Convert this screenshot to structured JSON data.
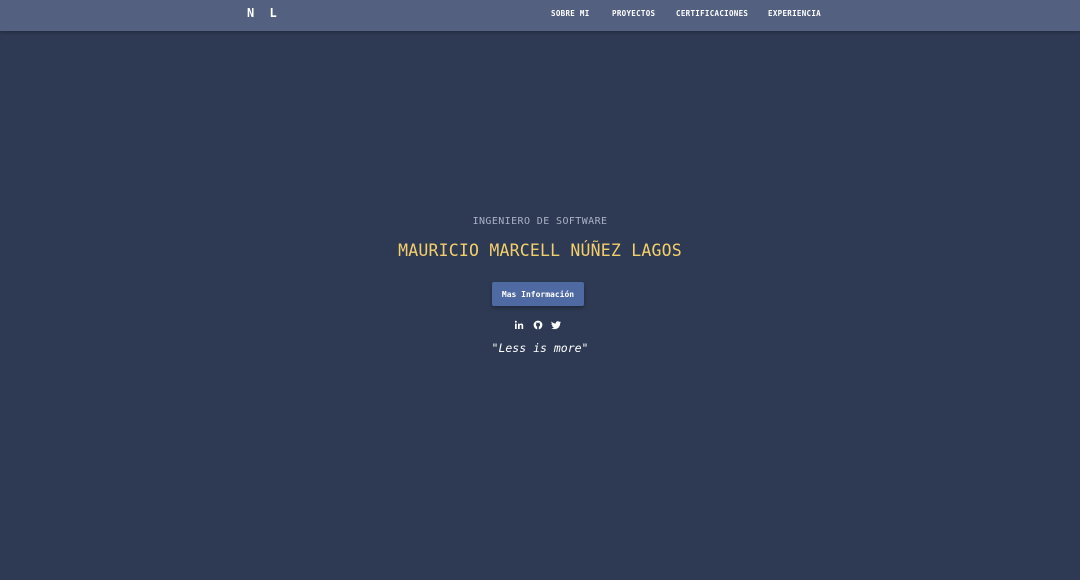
{
  "navbar": {
    "brand": "N L",
    "links": [
      {
        "label": "SOBRE MI"
      },
      {
        "label": "PROYECTOS"
      },
      {
        "label": "CERTIFICACIONES"
      },
      {
        "label": "EXPERIENCIA"
      }
    ]
  },
  "hero": {
    "subtitle": "INGENIERO DE SOFTWARE",
    "name": "MAURICIO MARCELL NÚÑEZ LAGOS",
    "button_label": "Mas Información",
    "socials": [
      {
        "icon": "linkedin-icon"
      },
      {
        "icon": "github-icon"
      },
      {
        "icon": "twitter-icon"
      }
    ],
    "quote": "\"Less is more\""
  },
  "colors": {
    "background": "#2e3a54",
    "navbar": "#536080",
    "accent": "#f3cf6c",
    "button": "#4f6aa3",
    "subtitle": "#aab2c6"
  }
}
